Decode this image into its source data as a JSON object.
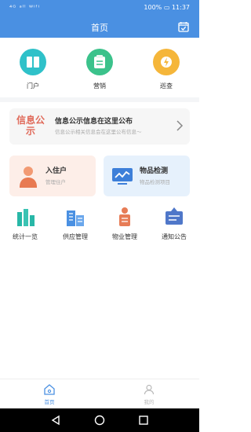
{
  "status_bar": {
    "left_text": "⁴ᴳ ᵃˡˡ ᵂⁱᶠⁱ",
    "battery": "100%",
    "time": "11:37"
  },
  "nav": {
    "title": "首页"
  },
  "quick_grid": [
    {
      "label": "门户",
      "color": "#2fc1c9"
    },
    {
      "label": "营销",
      "color": "#3bc28b"
    },
    {
      "label": "巡查",
      "color": "#f5b63a"
    }
  ],
  "notice": {
    "logo_text": "信息公示",
    "title": "信息公示信息在这里公布",
    "subtitle": "信息公示相关信息会在这里公布信息～"
  },
  "cards": [
    {
      "title": "入住户",
      "subtitle": "管理住户",
      "bg": "#fdeee8"
    },
    {
      "title": "物品检测",
      "subtitle": "物品检测项目",
      "bg": "#e6f1fc"
    }
  ],
  "feature_grid": [
    {
      "label": "统计一览",
      "color": "#28b7a7"
    },
    {
      "label": "供应管理",
      "color": "#4a90e2"
    },
    {
      "label": "物业管理",
      "color": "#e77c56"
    },
    {
      "label": "通知公告",
      "color": "#4f77c9"
    }
  ],
  "tabbar": [
    {
      "label": "首页",
      "active": true,
      "color": "#4a90e2"
    },
    {
      "label": "我的",
      "active": false,
      "color": "#b9b9b9"
    }
  ]
}
